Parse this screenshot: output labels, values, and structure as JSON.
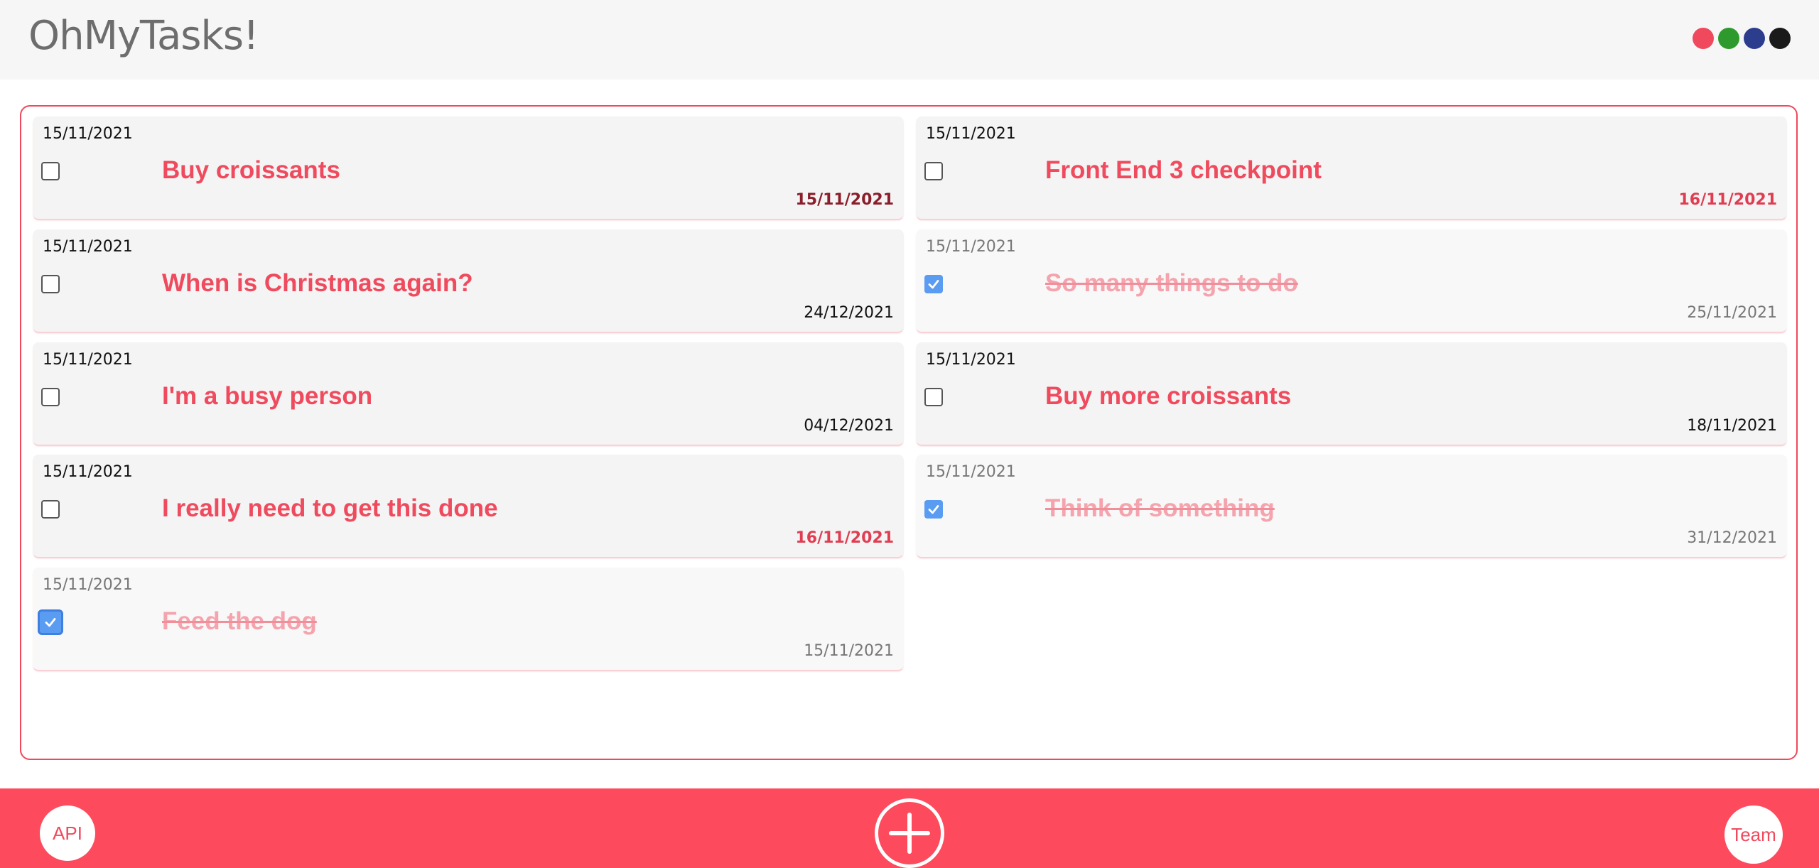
{
  "header": {
    "app_title": "OhMyTasks!",
    "theme_colors": [
      {
        "name": "red",
        "color": "#f0485d"
      },
      {
        "name": "green",
        "color": "#2e9a2e"
      },
      {
        "name": "blue",
        "color": "#2d3d8e"
      },
      {
        "name": "black",
        "color": "#1a1a1a"
      }
    ]
  },
  "tasks": [
    {
      "created": "15/11/2021",
      "title": "Buy croissants",
      "due": "15/11/2021",
      "done": false,
      "due_status": "today"
    },
    {
      "created": "15/11/2021",
      "title": "Front End 3 checkpoint",
      "due": "16/11/2021",
      "done": false,
      "due_status": "soon"
    },
    {
      "created": "15/11/2021",
      "title": "When is Christmas again?",
      "due": "24/12/2021",
      "done": false,
      "due_status": "normal"
    },
    {
      "created": "15/11/2021",
      "title": "So many things to do",
      "due": "25/11/2021",
      "done": true,
      "due_status": "normal"
    },
    {
      "created": "15/11/2021",
      "title": "I'm a busy person",
      "due": "04/12/2021",
      "done": false,
      "due_status": "normal"
    },
    {
      "created": "15/11/2021",
      "title": "Buy more croissants",
      "due": "18/11/2021",
      "done": false,
      "due_status": "normal"
    },
    {
      "created": "15/11/2021",
      "title": "I really need to get this done",
      "due": "16/11/2021",
      "done": false,
      "due_status": "soon"
    },
    {
      "created": "15/11/2021",
      "title": "Think of something",
      "due": "31/12/2021",
      "done": true,
      "due_status": "normal"
    },
    {
      "created": "15/11/2021",
      "title": "Feed the dog",
      "due": "15/11/2021",
      "done": true,
      "due_status": "normal",
      "focused": true
    }
  ],
  "footer": {
    "api_label": "API",
    "add_icon": "plus-circle-icon",
    "team_label": "Team"
  },
  "colors": {
    "accent": "#fd4a5d",
    "checkbox_checked": "#5a9cf2"
  }
}
